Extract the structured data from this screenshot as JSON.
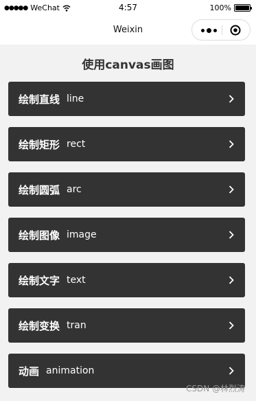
{
  "status_bar": {
    "carrier": "WeChat",
    "signal_dots": "●●●●●",
    "time": "4:57",
    "battery": "100%"
  },
  "navbar": {
    "title": "Weixin",
    "more_icon": "more-dots-icon",
    "close_icon": "close-target-icon"
  },
  "page": {
    "title": "使用canvas画图"
  },
  "menu": {
    "items": [
      {
        "cn": "绘制直线",
        "en": "line"
      },
      {
        "cn": "绘制矩形",
        "en": "rect"
      },
      {
        "cn": "绘制圆弧",
        "en": "arc"
      },
      {
        "cn": "绘制图像",
        "en": "image"
      },
      {
        "cn": "绘制文字",
        "en": "text"
      },
      {
        "cn": "绘制变换",
        "en": "tran"
      },
      {
        "cn": "动画",
        "en": "animation"
      }
    ]
  },
  "watermark": "CSDN @林烈涛",
  "colors": {
    "item_bg": "#333333",
    "page_bg": "#f2f2f2"
  }
}
